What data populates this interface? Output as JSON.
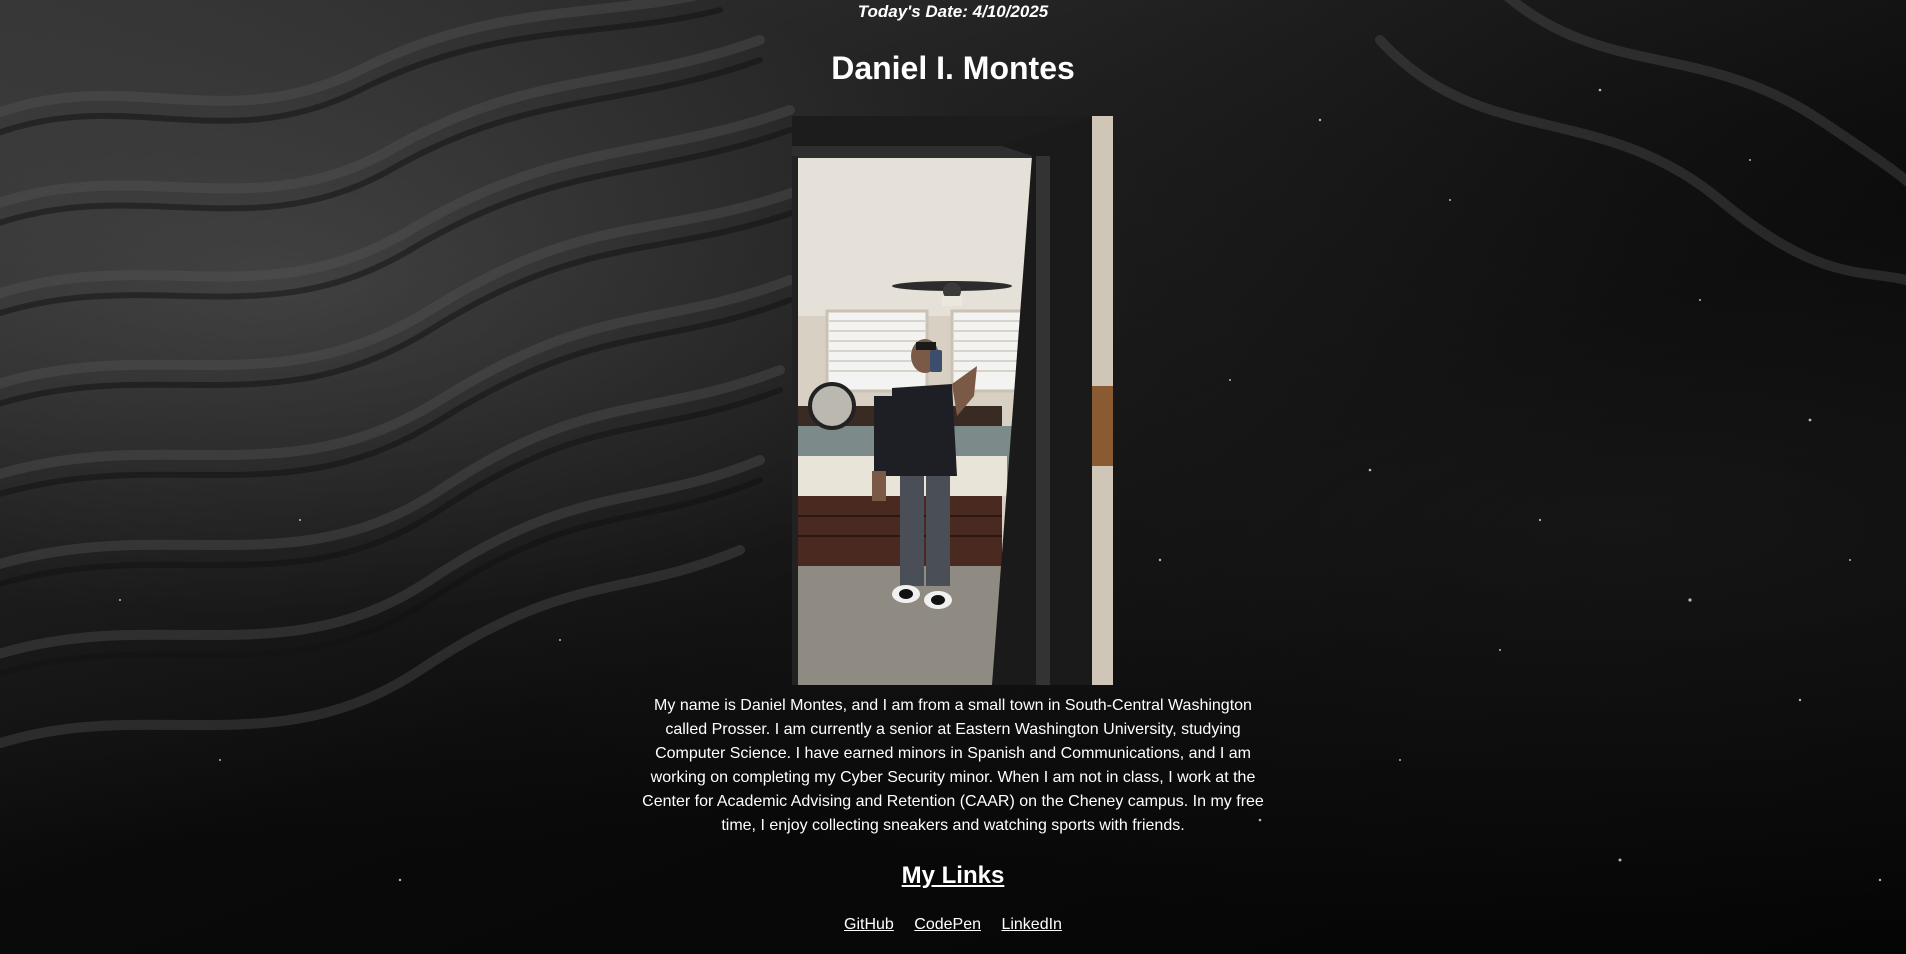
{
  "header": {
    "date_text": "Today's Date: 4/10/2025",
    "name": "Daniel I. Montes"
  },
  "photo": {
    "description_icon": "profile-photo"
  },
  "bio": {
    "text": "My name is Daniel Montes, and I am from a small town in South-Central Washington called Prosser. I am currently a senior at Eastern Washington University, studying Computer Science. I have earned minors in Spanish and Communications, and I am working on completing my Cyber Security minor. When I am not in class, I work at the Center for Academic Advising and Retention (CAAR) on the Cheney campus. In my free time, I enjoy collecting sneakers and watching sports with friends."
  },
  "links": {
    "heading": "My Links",
    "items": [
      {
        "label": "GitHub"
      },
      {
        "label": "CodePen"
      },
      {
        "label": "LinkedIn"
      }
    ]
  },
  "colors": {
    "text": "#ffffff",
    "background": "#0b0b0b"
  }
}
